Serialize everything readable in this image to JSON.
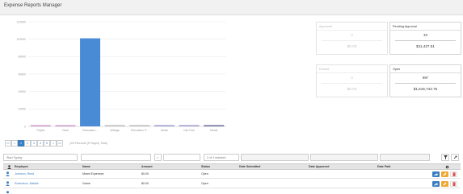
{
  "header": {
    "title": "Expense Reports Manager"
  },
  "chart_data": {
    "type": "bar",
    "categories": [
      "Flights",
      "Hotel",
      "Relocation...",
      "Mileage",
      "Relocation P...",
      "Meals",
      "Cab Fare",
      "Meals"
    ],
    "values": [
      1200,
      900,
      101000,
      350,
      350,
      900,
      450,
      1400
    ],
    "bar_colors": [
      "#cc99cc",
      "#cc99cc",
      "#4a8bd6",
      "#bbbbbb",
      "#bbbbbb",
      "#9a9acc",
      "#9a9acc",
      "#6a6a9a"
    ],
    "ylim": [
      0,
      120000
    ],
    "yticks": [
      0,
      20000,
      40000,
      60000,
      80000,
      100000,
      120000
    ],
    "ytick_labels": [
      "0",
      "20000",
      "40000",
      "60000",
      "80000",
      "100000",
      "120000"
    ],
    "grid": true,
    "title": "",
    "xlabel": "",
    "ylabel": ""
  },
  "cards": {
    "approved": {
      "label": "Approved",
      "count": "0",
      "amount": "$0.00"
    },
    "pending": {
      "label": "Pending Approval",
      "count": "33",
      "amount": "$11,427.51"
    },
    "denied": {
      "label": "Denied",
      "count": "0",
      "amount": "$0.00"
    },
    "open": {
      "label": "Open",
      "count": "997",
      "amount": "$1,616,742.76"
    }
  },
  "pager": {
    "first": "<<",
    "prev": "<",
    "pages": [
      "1",
      "2",
      "3",
      "4",
      "5"
    ],
    "next": ">",
    "last": ">>",
    "info": "(1/5 Records (5 Pages) Total)"
  },
  "filters": {
    "search_placeholder": "Start Typing",
    "amount_op": "=",
    "status_selected": "2 of 4 selected"
  },
  "table": {
    "columns": [
      "Employee",
      "Name",
      "Amount",
      "Status",
      "Date Submitted",
      "Date Approved",
      "Date Paid"
    ],
    "rows": [
      {
        "employee": "Johnson, Reed",
        "name": "Miami Expenses",
        "amount": "$0.00",
        "status": "Open"
      },
      {
        "employee": "Robertson, Natalie",
        "name": "Game",
        "amount": "$0.00",
        "status": "Open"
      }
    ]
  },
  "colors": {
    "accent": "#3a7fc1",
    "bar_main": "#4a8bd6",
    "edit": "#f0a830",
    "delete": "#d9534f"
  }
}
